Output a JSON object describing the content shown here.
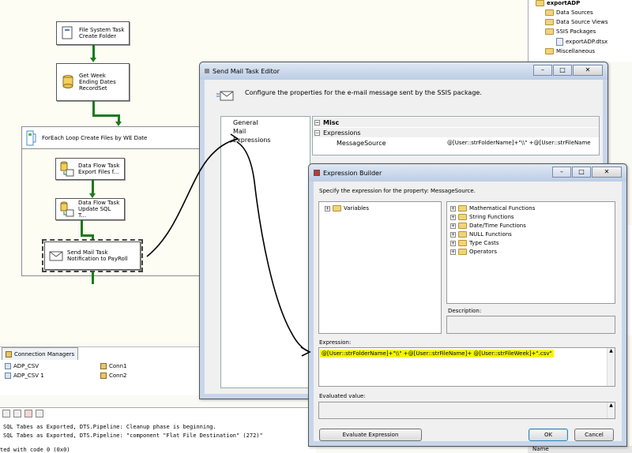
{
  "designer": {
    "tasks": {
      "file_system": "File System Task\nCreate Folder",
      "get_week": "Get Week\nEnding Dates\nRecordSet",
      "dft_export": "Data Flow Task\nExport Files f...",
      "dft_update": "Data Flow Task\nUpdate SQL T...",
      "send_mail": "Send Mail Task\nNotification to PayRoll"
    },
    "foreach_label": "ForEach Loop Create Files by WE Date"
  },
  "connection_managers": {
    "tab_label": "Connection Managers",
    "items": [
      "ADP_CSV",
      "ADP_CSV 1",
      "Conn1",
      "Conn2"
    ]
  },
  "output": {
    "lines": [
      "SQL Tabes as Exported, DTS.Pipeline: Cleanup phase is beginning.",
      "SQL Tabes as Exported, DTS.Pipeline: \"component \"Flat File Destination\" (272)\"",
      "ted with code 0 (0x0)"
    ]
  },
  "solution_explorer": {
    "project": "exportADP",
    "items": [
      "Data Sources",
      "Data Source Views",
      "SSIS Packages",
      "exportADP.dtsx",
      "Miscellaneous"
    ],
    "name_header": "Name"
  },
  "send_mail_editor": {
    "title": "Send Mail Task Editor",
    "description": "Configure the properties for the e-mail message sent by the SSIS package.",
    "nav": [
      "General",
      "Mail",
      "Expressions"
    ],
    "grid": {
      "section_misc": "Misc",
      "section_expressions": "Expressions",
      "property": "MessageSource",
      "value": "@[User::strFolderName]+\"\\\\\" +@[User::strFileName"
    }
  },
  "expression_builder": {
    "title": "Expression Builder",
    "instruction": "Specify the expression for the property: MessageSource.",
    "variables_label": "Variables",
    "functions": [
      "Mathematical Functions",
      "String Functions",
      "Date/Time Functions",
      "NULL Functions",
      "Type Casts",
      "Operators"
    ],
    "description_label": "Description:",
    "expression_label": "Expression:",
    "expression": "@[User::strFolderName]+\"\\\\\" +@[User::strFileName]+ @[User::strFileWeek]+\".csv\"",
    "evaluated_label": "Evaluated value:",
    "evaluate_button": "Evaluate Expression",
    "ok_button": "OK",
    "cancel_button": "Cancel",
    "highlight_color": "#f5f500"
  },
  "colors": {
    "precedence_arrow": "#1c7a1c",
    "window_frame": "#c7d6ea",
    "annotation_ink": "#000000"
  }
}
